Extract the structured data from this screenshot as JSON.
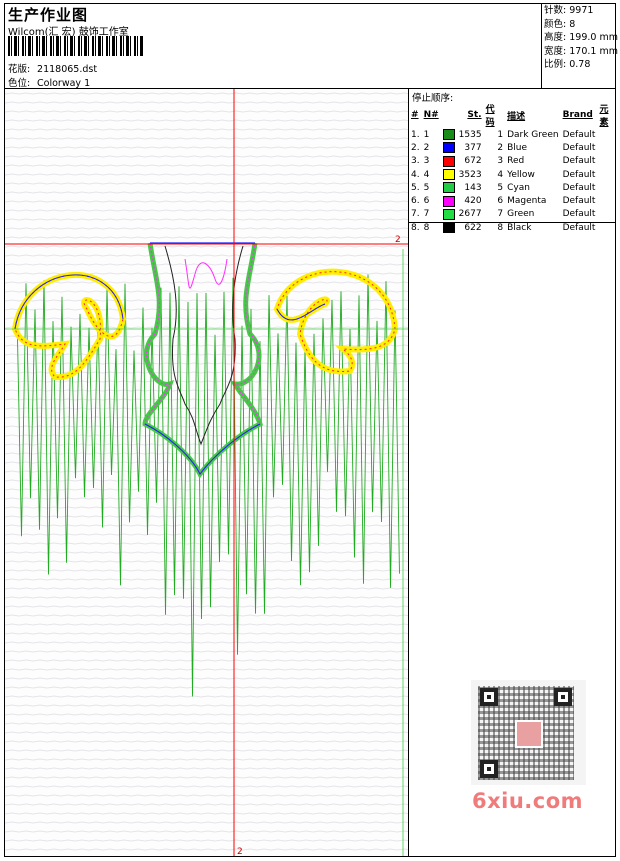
{
  "header": {
    "title": "生产作业图",
    "subtitle": "Wilcom(汇 宏) 鼓饰工作室",
    "pattern_label": "花版:",
    "pattern_value": "2118065.dst",
    "colorway_label": "色位:",
    "colorway_value": "Colorway 1"
  },
  "stats": [
    {
      "label": "针数:",
      "value": "9971"
    },
    {
      "label": "颜色:",
      "value": "8"
    },
    {
      "label": "高度:",
      "value": "199.0 mm"
    },
    {
      "label": "宽度:",
      "value": "170.1 mm"
    },
    {
      "label": "比例:",
      "value": "0.78"
    }
  ],
  "stop_sequence": {
    "title": "停止顺序:",
    "headers": [
      "#",
      "N#",
      "St.",
      "代码",
      "描述",
      "Brand",
      "元素"
    ],
    "rows": [
      {
        "idx": "1.",
        "n": "1",
        "color": "#1a8c1a",
        "st": "1535",
        "code": "1",
        "desc": "Dark Green",
        "brand": "Default"
      },
      {
        "idx": "2.",
        "n": "2",
        "color": "#0000ff",
        "st": "377",
        "code": "2",
        "desc": "Blue",
        "brand": "Default"
      },
      {
        "idx": "3.",
        "n": "3",
        "color": "#ff0000",
        "st": "672",
        "code": "3",
        "desc": "Red",
        "brand": "Default"
      },
      {
        "idx": "4.",
        "n": "4",
        "color": "#ffff00",
        "st": "3523",
        "code": "4",
        "desc": "Yellow",
        "brand": "Default"
      },
      {
        "idx": "5.",
        "n": "5",
        "color": "#22cc44",
        "st": "143",
        "code": "5",
        "desc": "Cyan",
        "brand": "Default"
      },
      {
        "idx": "6.",
        "n": "6",
        "color": "#ff00ff",
        "st": "420",
        "code": "6",
        "desc": "Magenta",
        "brand": "Default"
      },
      {
        "idx": "7.",
        "n": "7",
        "color": "#22dd44",
        "st": "2677",
        "code": "7",
        "desc": "Green",
        "brand": "Default"
      },
      {
        "idx": "8.",
        "n": "8",
        "color": "#000000",
        "st": "622",
        "code": "8",
        "desc": "Black",
        "brand": "Default"
      }
    ]
  },
  "canvas": {
    "ref_h": "2",
    "ref_v": "2",
    "colors": {
      "guide": "#ff0000",
      "stitch_green": "#22aa22",
      "yellow": "#ffee00",
      "red": "#ff2020",
      "blue": "#2020ff",
      "magenta": "#ff30ff",
      "cyan_green": "#40cc40",
      "dark": "#222222"
    }
  },
  "watermark": {
    "text": "6xiu.com",
    "icon": "qr-code-icon"
  }
}
